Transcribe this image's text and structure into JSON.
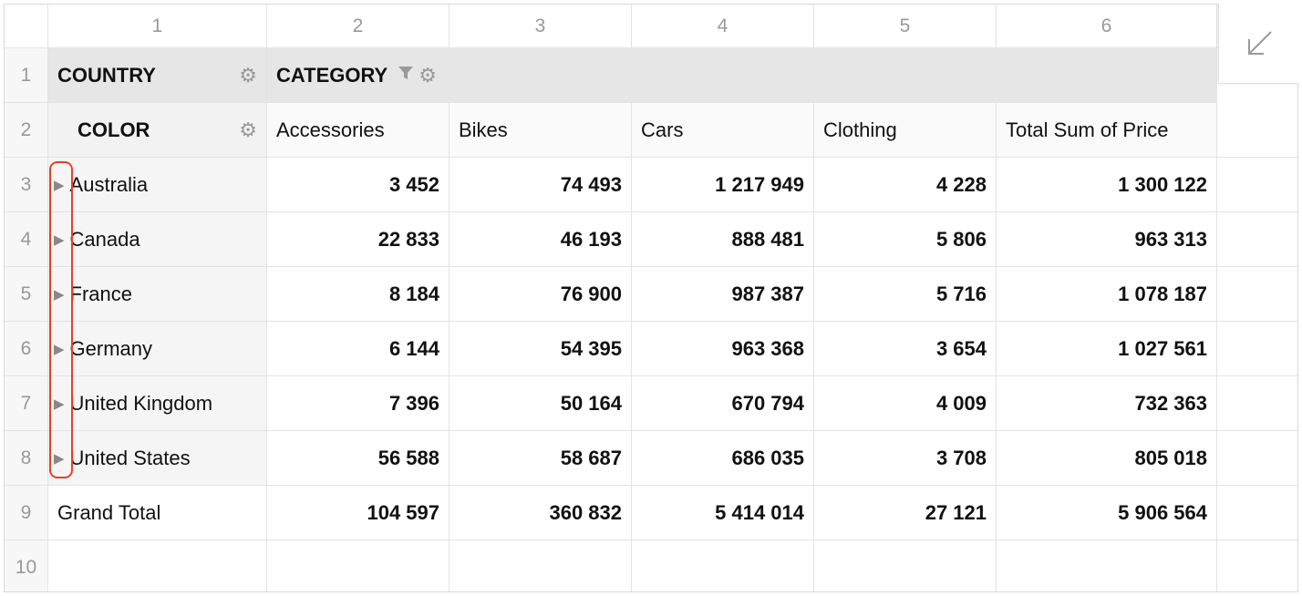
{
  "column_numbers": [
    "",
    "1",
    "2",
    "3",
    "4",
    "5",
    "6"
  ],
  "row_numbers": [
    "1",
    "2",
    "3",
    "4",
    "5",
    "6",
    "7",
    "8",
    "9",
    "10"
  ],
  "headers": {
    "row_field": "COUNTRY",
    "column_field": "CATEGORY",
    "sub_row_field": "COLOR"
  },
  "columns": [
    "Accessories",
    "Bikes",
    "Cars",
    "Clothing",
    "Total Sum of Price"
  ],
  "rows": [
    {
      "label": "Australia",
      "values": [
        "3 452",
        "74 493",
        "1 217 949",
        "4 228",
        "1 300 122"
      ]
    },
    {
      "label": "Canada",
      "values": [
        "22 833",
        "46 193",
        "888 481",
        "5 806",
        "963 313"
      ]
    },
    {
      "label": "France",
      "values": [
        "8 184",
        "76 900",
        "987 387",
        "5 716",
        "1 078 187"
      ]
    },
    {
      "label": "Germany",
      "values": [
        "6 144",
        "54 395",
        "963 368",
        "3 654",
        "1 027 561"
      ]
    },
    {
      "label": "United Kingdom",
      "values": [
        "7 396",
        "50 164",
        "670 794",
        "4 009",
        "732 363"
      ]
    },
    {
      "label": "United States",
      "values": [
        "56 588",
        "58 687",
        "686 035",
        "3 708",
        "805 018"
      ]
    }
  ],
  "grand_total": {
    "label": "Grand Total",
    "values": [
      "104 597",
      "360 832",
      "5 414 014",
      "27 121",
      "5 906 564"
    ]
  },
  "icons": {
    "gear": "gear-icon",
    "filter": "filter-icon",
    "expand": "expand-triangle-icon",
    "collapse_corner": "arrow-down-left-icon"
  },
  "colors": {
    "highlight": "#e8402a",
    "header_bar": "#e6e6e6",
    "row_label_bg": "#f5f5f5"
  }
}
